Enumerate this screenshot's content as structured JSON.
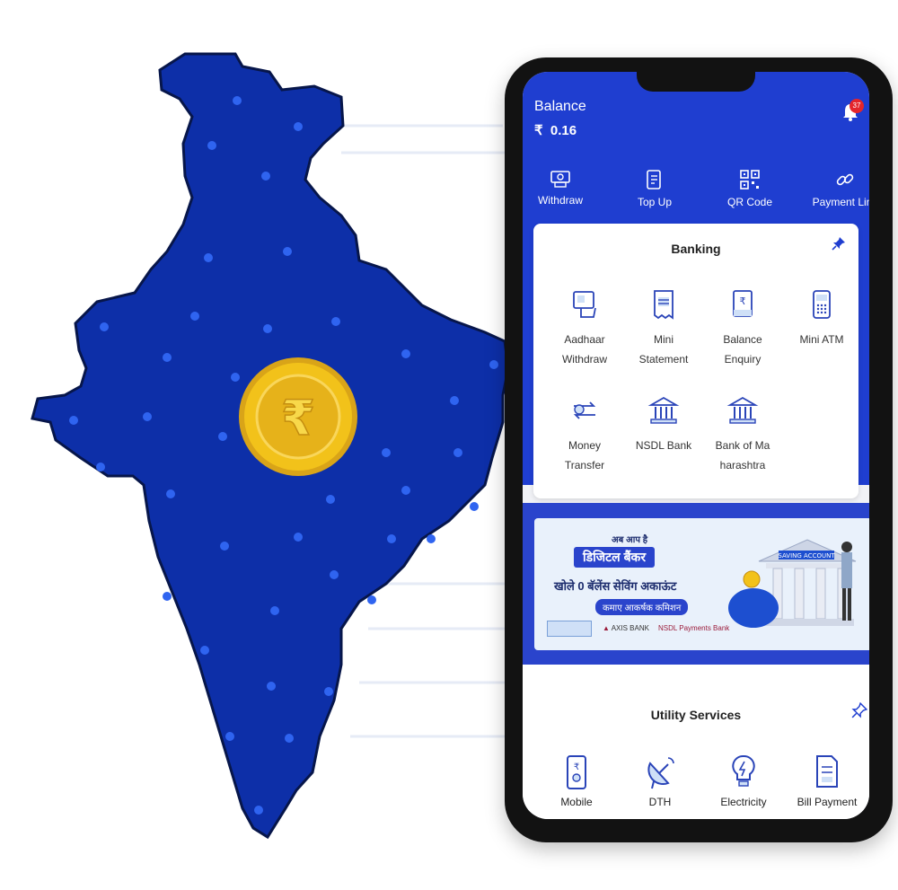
{
  "balance": {
    "label": "Balance",
    "currency": "₹",
    "amount": "0.16",
    "notification_count": "37"
  },
  "quick_actions": [
    {
      "label": "Withdraw",
      "icon": "withdraw-icon"
    },
    {
      "label": "Top Up",
      "icon": "top-up-icon"
    },
    {
      "label": "QR Code",
      "icon": "qr-code-icon"
    },
    {
      "label": "Payment Link",
      "icon": "link-icon"
    }
  ],
  "banking": {
    "title": "Banking",
    "items": [
      {
        "line1": "Aadhaar",
        "line2": "Withdraw",
        "icon": "aadhaar-withdraw-icon"
      },
      {
        "line1": "Mini",
        "line2": "Statement",
        "icon": "mini-statement-icon"
      },
      {
        "line1": "Balance",
        "line2": "Enquiry",
        "icon": "balance-enquiry-icon"
      },
      {
        "line1": "Mini ATM",
        "line2": "",
        "icon": "mini-atm-icon"
      },
      {
        "line1": "Money",
        "line2": "Transfer",
        "icon": "money-transfer-icon"
      },
      {
        "line1": "NSDL Bank",
        "line2": "",
        "icon": "bank-icon"
      },
      {
        "line1": "Bank of Ma",
        "line2": "harashtra",
        "icon": "bank-icon"
      }
    ]
  },
  "banner": {
    "line1": "अब आप है",
    "line2": "डिजिटल बैंकर",
    "line3": "खोले 0 बॅलेंस सेविंग अकाऊंट",
    "line4": "कमाए आकर्षक कमिशन",
    "sign": "SAVING ACCOUNT",
    "logos": [
      "AXIS BANK",
      "NSDL Payments Bank"
    ]
  },
  "utility": {
    "title": "Utility Services",
    "items": [
      {
        "label": "Mobile",
        "icon": "mobile-icon"
      },
      {
        "label": "DTH",
        "icon": "dth-icon"
      },
      {
        "label": "Electricity",
        "icon": "electricity-icon"
      },
      {
        "label": "Bill Payment",
        "icon": "bill-payment-icon"
      }
    ]
  },
  "colors": {
    "primary": "#1f3ed0",
    "map": "#0d2fa8",
    "coin": "#f2c21a",
    "icon": "#2a44b8"
  }
}
